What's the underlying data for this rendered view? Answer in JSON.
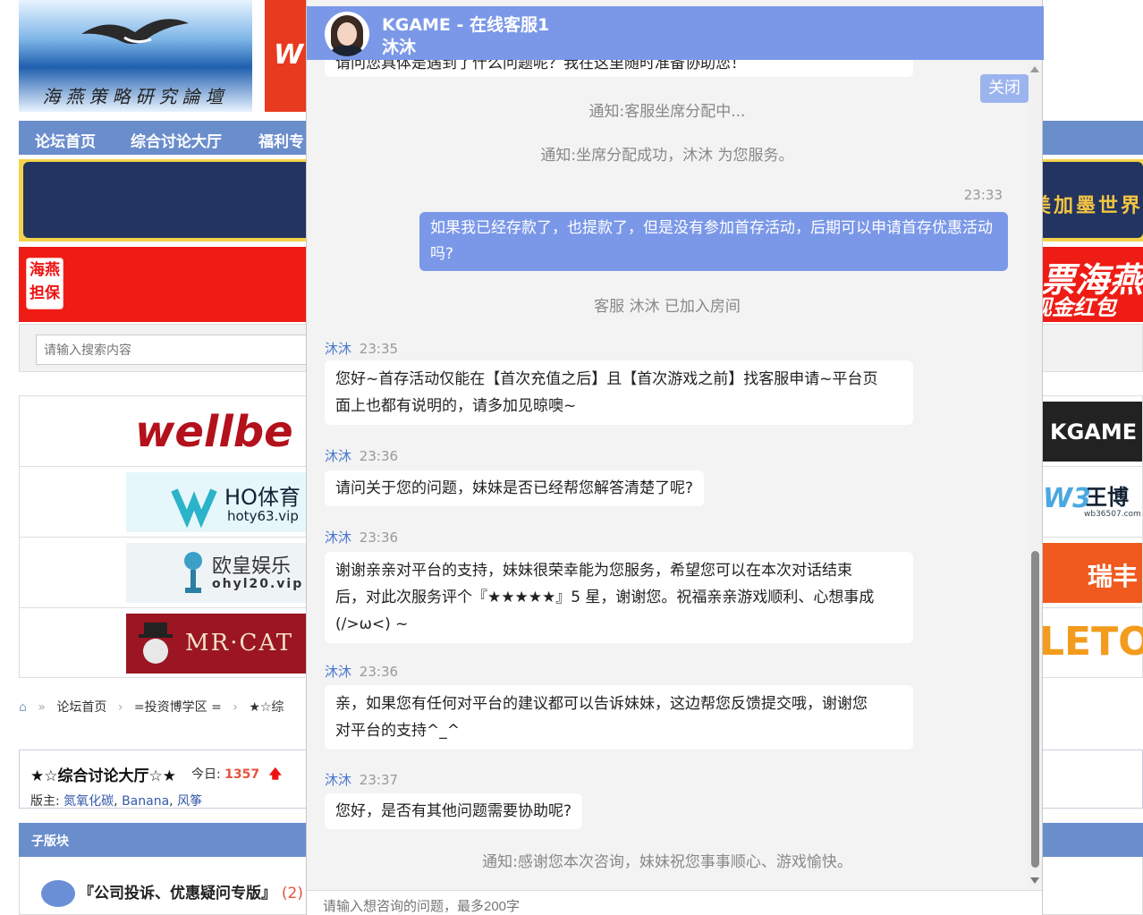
{
  "forum": {
    "logo_text": "海燕策略研究論壇",
    "nav": [
      "论坛首页",
      "综合讨论大厅",
      "福利专"
    ],
    "red_badge": [
      "海燕",
      "担保"
    ],
    "blue_banner_text": "美加墨世界",
    "red_banner_text": "票海燕",
    "red_banner_text2": "现金红包",
    "search_placeholder": "请输入搜索内容",
    "ads": {
      "wellbet": "wellbe",
      "ho_title": "HO体育",
      "ho_domain": "hoty63.vip",
      "oh_title": "欧皇娱乐",
      "oh_domain": "ohyl20.vip",
      "mrcat": "MR·CAT",
      "kgame": "KGAME",
      "wb_title": "王博",
      "wb_domain": "wb36507.com",
      "ruifeng": "瑞丰",
      "letou": "LETOU"
    },
    "breadcrumb": [
      "论坛首页",
      "=投资博学区 =",
      "★☆综"
    ],
    "board_title": "★☆综合讨论大厅☆★",
    "today_label": "今日:",
    "today_count": "1357",
    "moderators_label": "版主:",
    "moderators": [
      "氮氧化碳",
      "Banana",
      "风筝"
    ],
    "subforum_bar": "子版块",
    "subforum_title": "『公司投诉、优惠疑问专版』",
    "subforum_count": "(2)"
  },
  "chat": {
    "title": "KGAME - 在线客服1",
    "agent": "沐沐",
    "close_label": "关闭",
    "cut_top_message": "请问您具体是遇到了什么问题呢？我在这里随时准备协助您！",
    "notice_assigning": "通知:客服坐席分配中...",
    "notice_assigned": "通知:坐席分配成功，沐沐 为您服务。",
    "user_time": "23:33",
    "user_message": "如果我已经存款了，也提款了，但是没有参加首存活动，后期可以申请首存优惠活动吗?",
    "joined_notice": "客服 沐沐 已加入房间",
    "messages": [
      {
        "who": "沐沐",
        "time": "23:35",
        "line1": "您好~首存活动仅能在【首次充值之后】且【首次游戏之前】找客服申请~平台页",
        "line2": "面上也都有说明的，请多加见晾噢~",
        "line3": ""
      },
      {
        "who": "沐沐",
        "time": "23:36",
        "line1": "请问关于您的问题，妹妹是否已经帮您解答清楚了呢?",
        "line2": "",
        "line3": ""
      },
      {
        "who": "沐沐",
        "time": "23:36",
        "line1": "谢谢亲亲对平台的支持，妹妹很荣幸能为您服务，希望您可以在本次对话结束",
        "line2": "后，对此次服务评个『★★★★★』5 星，谢谢您。祝福亲亲游戏顺利、心想事成",
        "line3": "(/>ω<) ~"
      },
      {
        "who": "沐沐",
        "time": "23:36",
        "line1": "亲，如果您有任何对平台的建议都可以告诉妹妹，这边帮您反馈提交哦，谢谢您",
        "line2": "对平台的支持^_^",
        "line3": ""
      },
      {
        "who": "沐沐",
        "time": "23:37",
        "line1": "您好，是否有其他问题需要协助呢?",
        "line2": "",
        "line3": ""
      }
    ],
    "notice_end": "通知:感谢您本次咨询，妹妹祝您事事顺心、游戏愉快。",
    "input_placeholder": "请输入想咨询的问题，最多200字"
  },
  "colors": {
    "chat_header": "#7b98e8",
    "nav_blue": "#6a8dcc",
    "accent_red": "#e5533c"
  }
}
